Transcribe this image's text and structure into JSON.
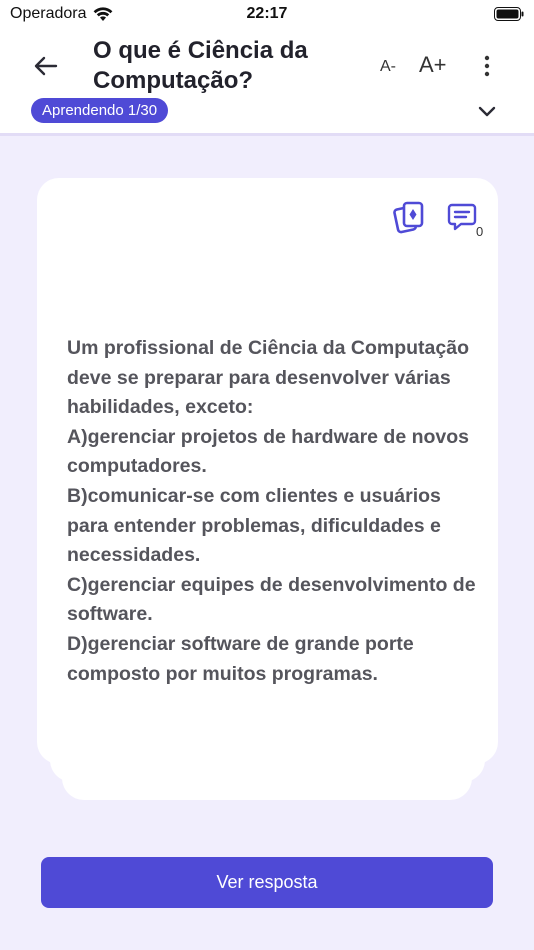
{
  "status_bar": {
    "carrier": "Operadora",
    "time": "22:17"
  },
  "header": {
    "title": "O que é Ciência da Computação?",
    "font_decrease_label": "A-",
    "font_increase_label": "A+",
    "progress_badge": "Aprendendo 1/30"
  },
  "card": {
    "comment_count": "0",
    "question": "Um profissional de Ciência da Computação deve se preparar para desenvolver várias habilidades, exceto:\nA)gerenciar projetos de hardware de novos computadores.\nB)comunicar-se com clientes e usuários para entender problemas, dificuldades e necessidades.\nC)gerenciar equipes de desenvolvimento de software.\nD)gerenciar software de grande porte composto por muitos programas."
  },
  "footer": {
    "answer_button": "Ver resposta"
  },
  "icons": {
    "back": "arrow-left-icon",
    "more": "more-vertical-icon",
    "expand": "chevron-down-icon",
    "flashcards": "flashcards-icon",
    "comments": "comment-icon"
  },
  "colors": {
    "accent": "#4f4ad6",
    "background": "#f1eefd",
    "card": "#ffffff"
  }
}
